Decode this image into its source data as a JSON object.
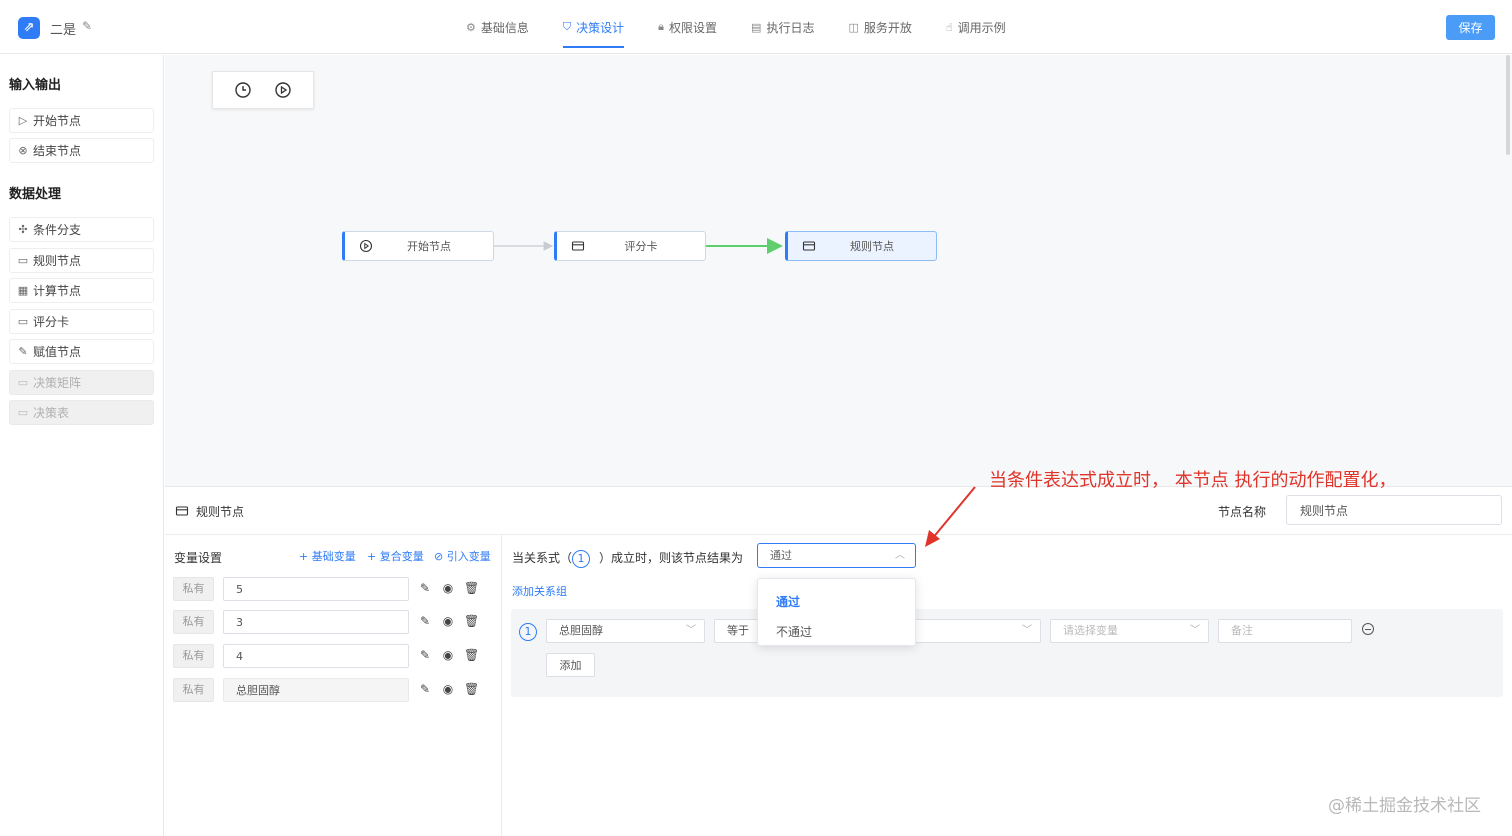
{
  "header": {
    "logo_glyph": "⇗",
    "app_title": "二是",
    "edit_icon": "pencil-icon",
    "tabs": [
      {
        "label": "基础信息",
        "icon": "gear-icon"
      },
      {
        "label": "决策设计",
        "icon": "design-icon"
      },
      {
        "label": "权限设置",
        "icon": "lock-icon"
      },
      {
        "label": "执行日志",
        "icon": "document-icon"
      },
      {
        "label": "服务开放",
        "icon": "book-icon"
      },
      {
        "label": "调用示例",
        "icon": "hand-icon"
      }
    ],
    "active_tab": "决策设计",
    "save_label": "保存"
  },
  "sidebar": {
    "section1": "输入输出",
    "section1_items": [
      {
        "label": "开始节点",
        "icon": "play-circle-icon",
        "disabled": false
      },
      {
        "label": "结束节点",
        "icon": "close-circle-icon",
        "disabled": false
      }
    ],
    "section2": "数据处理",
    "section2_items": [
      {
        "label": "条件分支",
        "icon": "branch-icon",
        "disabled": false
      },
      {
        "label": "规则节点",
        "icon": "card-icon",
        "disabled": false
      },
      {
        "label": "计算节点",
        "icon": "calculator-icon",
        "disabled": false
      },
      {
        "label": "评分卡",
        "icon": "card-icon",
        "disabled": false
      },
      {
        "label": "赋值节点",
        "icon": "edit-square-icon",
        "disabled": false
      },
      {
        "label": "决策矩阵",
        "icon": "card-icon",
        "disabled": true
      },
      {
        "label": "决策表",
        "icon": "card-icon",
        "disabled": true
      }
    ]
  },
  "canvas": {
    "toolbar": [
      "clock-icon",
      "play-circle-icon"
    ],
    "nodes": [
      {
        "label": "开始节点",
        "icon": "play-circle-icon",
        "selected": false
      },
      {
        "label": "评分卡",
        "icon": "card-icon",
        "selected": false
      },
      {
        "label": "规则节点",
        "icon": "card-icon",
        "selected": true
      }
    ],
    "edge_colors": {
      "default": "#c8ccd2",
      "active": "#5fcf6d"
    }
  },
  "panel": {
    "title": "规则节点",
    "node_name_label": "节点名称",
    "node_name_value": "规则节点",
    "variables": {
      "title": "变量设置",
      "links": [
        "+ 基础变量",
        "+ 复合变量",
        "⊘ 引入变量"
      ],
      "rows": [
        {
          "tag": "私有",
          "value": "5"
        },
        {
          "tag": "私有",
          "value": "3"
        },
        {
          "tag": "私有",
          "value": "4"
        },
        {
          "tag": "私有",
          "value": "总胆固醇"
        }
      ]
    },
    "rule": {
      "cond_prefix": "当关系式（",
      "cond_num": "1",
      "cond_suffix": "）成立时，则该节点结果为",
      "result_value": "通过",
      "add_group": "添加关系组",
      "group_num": "1",
      "field_value": "总胆固醇",
      "operator_value": "等于",
      "var_placeholder": "请选择变量",
      "remark_placeholder": "备注",
      "add_button": "添加",
      "dropdown_options": [
        {
          "label": "通过",
          "selected": true
        },
        {
          "label": "不通过",
          "selected": false
        }
      ]
    }
  },
  "annotation": "当条件表达式成立时， 本节点 执行的动作配置化，",
  "watermark": "@稀土掘金技术社区",
  "colors": {
    "accent": "#2f7cf6",
    "annotation": "#e0342a"
  }
}
